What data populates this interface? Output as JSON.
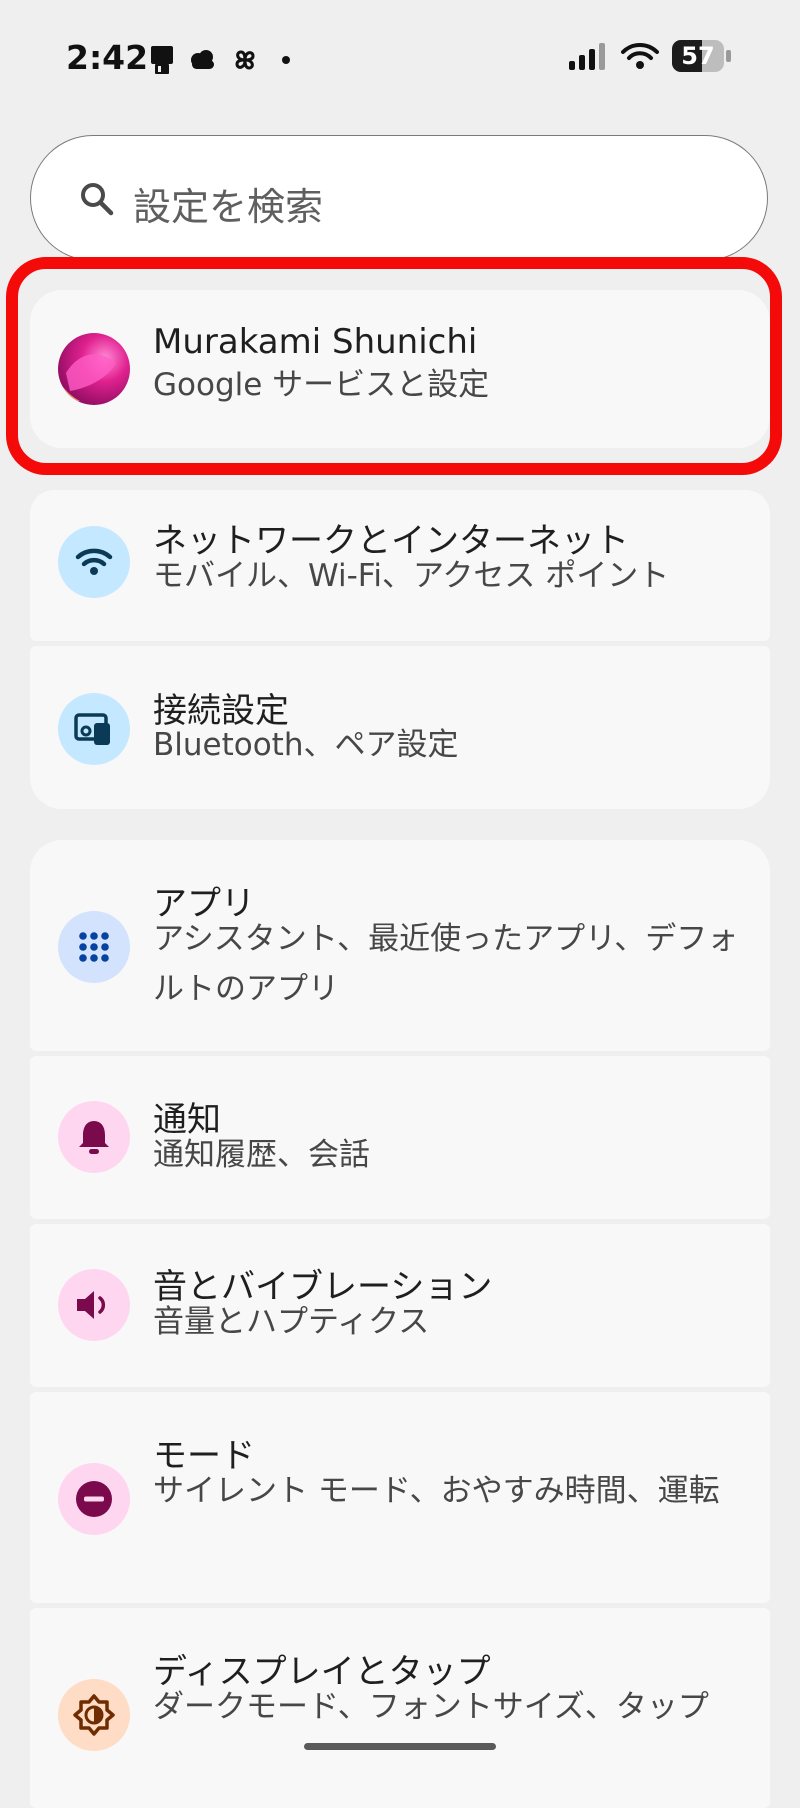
{
  "status_bar": {
    "time": "2:42",
    "battery": "57",
    "battery_level": 0.57
  },
  "search": {
    "placeholder": "設定を検索"
  },
  "account": {
    "name": "Murakami Shunichi",
    "subtitle": "Google サービスと設定"
  },
  "settings": [
    {
      "title": "ネットワークとインターネット",
      "subtitle": "モバイル、Wi-Fi、アクセス ポイント",
      "icon": "wifi-icon",
      "icon_bg": "#c3e8ff",
      "icon_color": "#0b3a57"
    },
    {
      "title": "接続設定",
      "subtitle": "Bluetooth、ペア設定",
      "icon": "connected-devices-icon",
      "icon_bg": "#c3e8ff",
      "icon_color": "#0b3a57"
    },
    {
      "title": "アプリ",
      "subtitle": "アシスタント、最近使ったアプリ、デフォルトのアプリ",
      "icon": "apps-grid-icon",
      "icon_bg": "#d3e3fd",
      "icon_color": "#0842a0"
    },
    {
      "title": "通知",
      "subtitle": "通知履歴、会話",
      "icon": "bell-icon",
      "icon_bg": "#ffd6f0",
      "icon_color": "#7a0a4c"
    },
    {
      "title": "音とバイブレーション",
      "subtitle": "音量とハプティクス",
      "icon": "speaker-icon",
      "icon_bg": "#ffd6f0",
      "icon_color": "#7a0a4c"
    },
    {
      "title": "モード",
      "subtitle": "サイレント モード、おやすみ時間、運転",
      "icon": "do-not-disturb-icon",
      "icon_bg": "#ffd6f0",
      "icon_color": "#7a0a4c"
    },
    {
      "title": "ディスプレイとタップ",
      "subtitle": "ダークモード、フォントサイズ、タップ",
      "icon": "brightness-icon",
      "icon_bg": "#ffdcc5",
      "icon_color": "#6e2c00"
    }
  ],
  "colors": {
    "highlight": "#f50a0a",
    "background": "#efefef",
    "card": "#f8f8f8"
  }
}
